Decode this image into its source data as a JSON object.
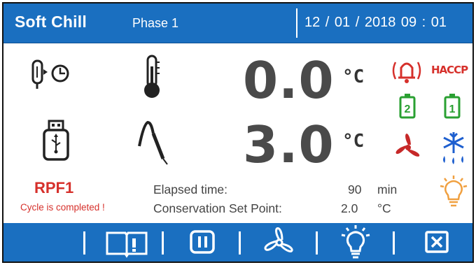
{
  "header": {
    "title": "Soft Chill",
    "phase": "Phase 1",
    "datetime": "12 / 01 / 2018   09 : 01"
  },
  "readings": {
    "temp1": "0.0",
    "temp1_unit": "°C",
    "temp2": "3.0",
    "temp2_unit": "°C"
  },
  "status": {
    "program": "RPF1",
    "message": "Cycle is completed !"
  },
  "info": {
    "elapsed_label": "Elapsed time:",
    "elapsed_value": "90",
    "elapsed_unit": "min",
    "setpoint_label": "Conservation Set Point:",
    "setpoint_value": "2.0",
    "setpoint_unit": "°C"
  },
  "right_icons": {
    "haccp_label": "HACCP",
    "probe2_number": "2",
    "probe1_number": "1"
  },
  "footer": {
    "buttons": [
      "manual-book-icon",
      "pause-icon",
      "fan-icon",
      "light-bulb-icon",
      "close-icon"
    ]
  },
  "colors": {
    "header_blue": "#1a6fc0",
    "alert_red": "#d6302b",
    "ok_green": "#2aa032",
    "defrost_blue": "#1e5fcf",
    "bulb_orange": "#f0a040"
  }
}
